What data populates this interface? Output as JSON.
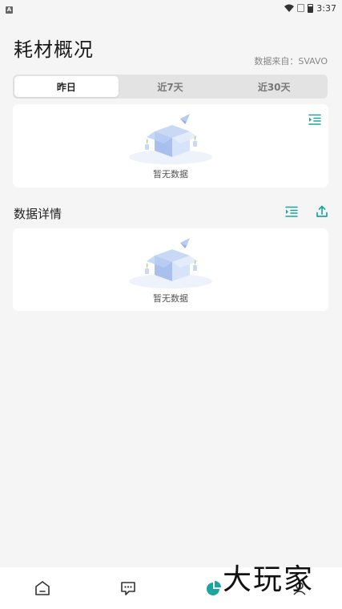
{
  "status_bar": {
    "time": "3:37",
    "left_icon": "app-notification-icon",
    "right_icons": [
      "wifi-icon",
      "notification-muted-icon",
      "battery-icon"
    ]
  },
  "header": {
    "title": "耗材概况",
    "data_source": "数据来自：SVAVO"
  },
  "tabs": [
    {
      "label": "昨日",
      "active": true
    },
    {
      "label": "近7天",
      "active": false
    },
    {
      "label": "近30天",
      "active": false
    }
  ],
  "overview_card": {
    "empty_text": "暂无数据",
    "action_icon": "list-indent-icon"
  },
  "details_section": {
    "title": "数据详情",
    "actions": [
      "list-indent-icon",
      "export-icon"
    ],
    "empty_text": "暂无数据"
  },
  "bottom_nav": [
    {
      "icon": "home-icon",
      "active": false
    },
    {
      "icon": "message-icon",
      "active": false
    },
    {
      "icon": "pie-chart-icon",
      "active": true
    },
    {
      "icon": "profile-icon",
      "active": false
    }
  ],
  "watermark": "大玩家",
  "colors": {
    "accent": "#1aa5a0",
    "background": "#f5f5f5",
    "card": "#ffffff",
    "segment_bg": "#e3e3e3"
  }
}
